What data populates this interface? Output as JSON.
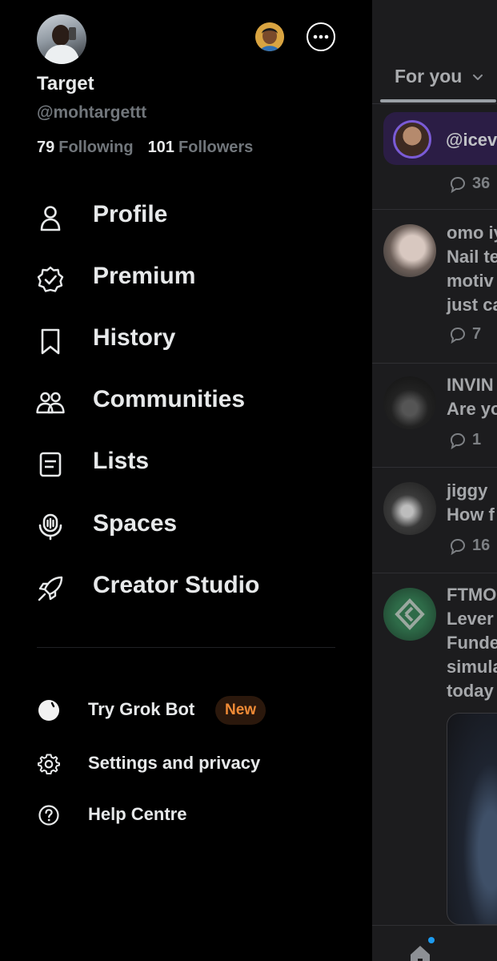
{
  "profile": {
    "display_name": "Target",
    "handle": "@mohtargettt",
    "following_count": "79",
    "following_label": "Following",
    "followers_count": "101",
    "followers_label": "Followers"
  },
  "menu": {
    "items": [
      {
        "label": "Profile",
        "icon": "person-icon"
      },
      {
        "label": "Premium",
        "icon": "verified-badge-icon"
      },
      {
        "label": "History",
        "icon": "bookmark-icon"
      },
      {
        "label": "Communities",
        "icon": "people-icon"
      },
      {
        "label": "Lists",
        "icon": "list-icon"
      },
      {
        "label": "Spaces",
        "icon": "microphone-icon"
      },
      {
        "label": "Creator Studio",
        "icon": "rocket-icon"
      }
    ]
  },
  "secondary": {
    "grok_label": "Try Grok Bot",
    "grok_badge": "New",
    "settings_label": "Settings and privacy",
    "help_label": "Help Centre"
  },
  "feed": {
    "tab_label": "For you",
    "space_handle": "@icev",
    "posts": [
      {
        "lines": [],
        "stat": "36"
      },
      {
        "lines": [
          "omo iy",
          "Nail te",
          "motiv",
          "just ca"
        ],
        "stat": "7"
      },
      {
        "lines": [
          "INVIN",
          "Are yo"
        ],
        "stat": "1"
      },
      {
        "lines": [
          "jiggy",
          "How f"
        ],
        "stat": "16"
      },
      {
        "lines": [
          "FTMO",
          "Lever",
          "Funde",
          "simula",
          "today"
        ],
        "stat": ""
      }
    ]
  },
  "colors": {
    "background": "#000000",
    "text_primary": "#e7e9ea",
    "text_secondary": "#71767b",
    "badge_new_text": "#f08b36",
    "badge_new_bg": "#2b180c",
    "accent_blue": "#1d9bf0"
  }
}
